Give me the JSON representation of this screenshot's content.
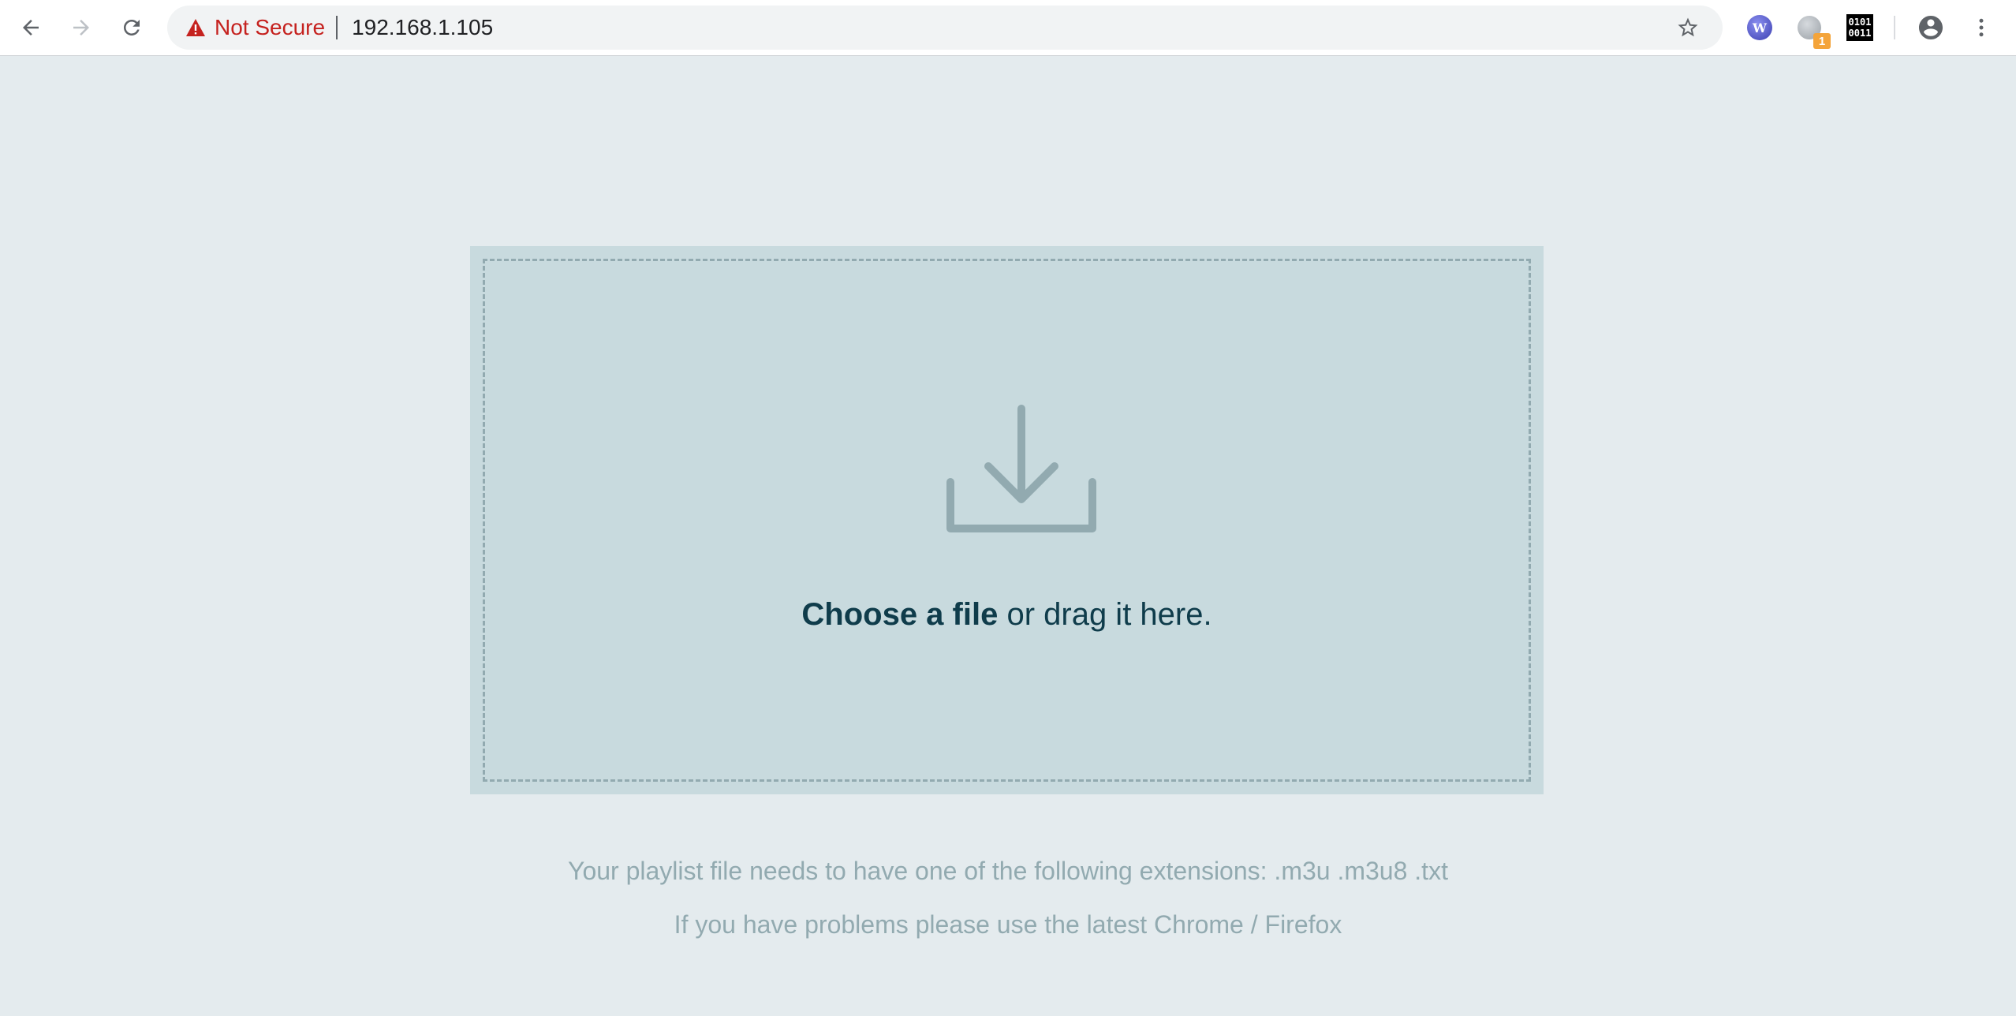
{
  "browser": {
    "security_label": "Not Secure",
    "url": "192.168.1.105",
    "extensions": [
      {
        "name": "wikiwand-extension-icon",
        "glyph": "W"
      },
      {
        "name": "grey-extension-icon",
        "badge": "1"
      },
      {
        "name": "binary-extension-icon",
        "line1": "0101",
        "line2": "0011"
      }
    ]
  },
  "dropzone": {
    "choose_label": "Choose a file",
    "drag_label": " or drag it here."
  },
  "hints": {
    "extensions": "Your playlist file needs to have one of the following extensions: .m3u .m3u8 .txt",
    "browsers": "If you have problems please use the latest Chrome / Firefox"
  },
  "colors": {
    "page_background": "#e4ebee",
    "dropzone_background": "#c8dade",
    "dropzone_border": "#92aab0",
    "primary_text": "#0f3c4b",
    "hint_text": "#92aab0",
    "insecure_red": "#c5221f"
  }
}
